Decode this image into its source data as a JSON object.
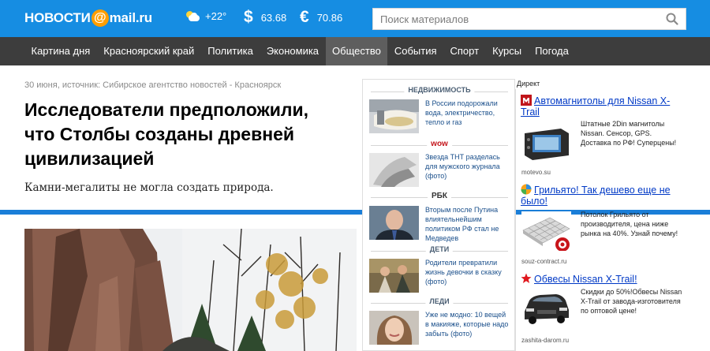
{
  "header": {
    "logo_text": "НОВОСТИ",
    "logo_at": "@",
    "logo_domain": "mail.ru",
    "weather": "+22°",
    "usd_symbol": "$",
    "usd": "63.68",
    "eur_symbol": "€",
    "eur": "70.86",
    "search_placeholder": "Поиск материалов"
  },
  "nav": {
    "items": [
      {
        "label": "Картина дня"
      },
      {
        "label": "Красноярский край"
      },
      {
        "label": "Политика"
      },
      {
        "label": "Экономика"
      },
      {
        "label": "Общество"
      },
      {
        "label": "События"
      },
      {
        "label": "Спорт"
      },
      {
        "label": "Курсы"
      },
      {
        "label": "Погода"
      }
    ],
    "active": "Общество"
  },
  "article": {
    "meta": "30 июня, источник: Сибирское агентство новостей - Красноярск",
    "title": "Исследователи предположили, что Столбы созданы древней цивилизацией",
    "lead": "Камни-мегалиты не могла создать природа."
  },
  "mid": {
    "blocks": [
      {
        "label": "НЕДВИЖИМОСТЬ",
        "text": "В России подорожали вода, электричество, тепло и газ"
      },
      {
        "label": "wow",
        "text": "Звезда ТНТ разделась для мужского журнала (фото)"
      },
      {
        "label": "РБК",
        "text": "Вторым после Путина влиятельнейшим политиком РФ стал не Медведев"
      },
      {
        "label": "ДЕТИ",
        "text": "Родители превратили жизнь девочки в сказку (фото)"
      },
      {
        "label": "ЛЕДИ",
        "text": "Уже не модно: 10 вещей в макияже, которые надо забыть (фото)"
      }
    ]
  },
  "direct": {
    "label": "Директ",
    "ads": [
      {
        "title": "Автомагнитолы для Nissan X-Trail",
        "text": "Штатные 2Din магнитолы Nissan. Сенсор, GPS. Доставка по РФ! Суперцены!",
        "domain": "motevo.su"
      },
      {
        "title": "Грильято! Так дешево еще не было!",
        "text": "Потолок Грильято от производителя, цена ниже рынка на 40%. Узнай почему!",
        "domain": "souz-contract.ru"
      },
      {
        "title": "Обвесы Nissan X-Trail!",
        "text": "Скидки до 50%!Обвесы Nissan X-Trail от завода-изготовителя по оптовой цене!",
        "domain": "zashita-darom.ru"
      }
    ]
  },
  "colors": {
    "header_blue": "#168de2",
    "nav_dark": "#3d3d3d",
    "nav_active": "#5e5e5e",
    "logo_orange": "#ff9e00",
    "link_blue": "#1a4f8b",
    "ad_link": "#0039c6"
  }
}
